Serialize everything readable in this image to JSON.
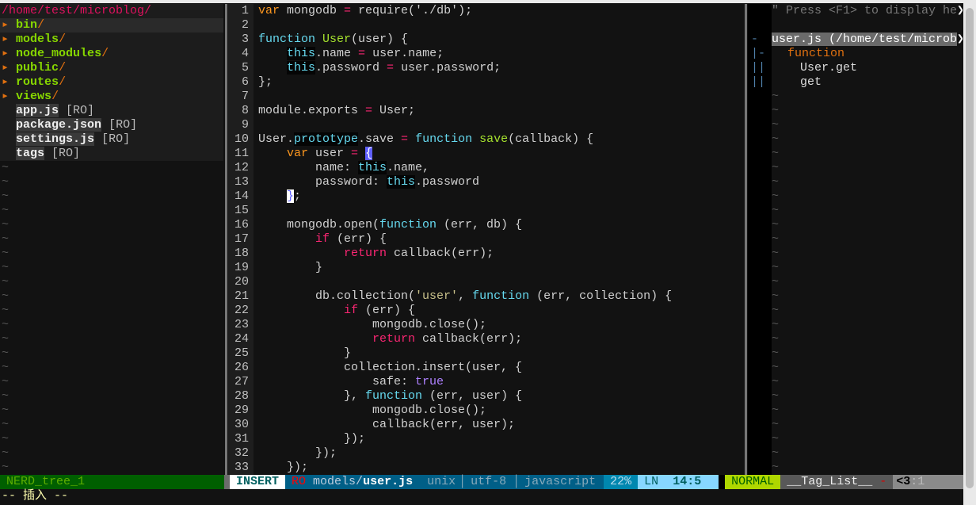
{
  "tree": {
    "root": "/home/test/microblog/",
    "dirs": [
      "bin",
      "models",
      "node_modules",
      "public",
      "routes",
      "views"
    ],
    "files": [
      "app.js",
      "package.json",
      "settings.js",
      "tags"
    ],
    "ro_label": "[RO]",
    "dir_arrow": "▸"
  },
  "code": {
    "lines": [
      [
        [
          "var",
          "kw"
        ],
        " mongodb ",
        [
          "=",
          "op"
        ],
        " require('./db');"
      ],
      [],
      [
        [
          "function",
          "fn"
        ],
        " ",
        [
          "User",
          "def"
        ],
        "(user) {"
      ],
      [
        "    ",
        [
          "this",
          "this"
        ],
        ".name ",
        [
          "=",
          "op"
        ],
        " user.name;"
      ],
      [
        "    ",
        [
          "this",
          "this"
        ],
        ".password ",
        [
          "=",
          "op"
        ],
        " user.password;"
      ],
      [
        "};"
      ],
      [],
      [
        "module.exports ",
        [
          "=",
          "op"
        ],
        " User;"
      ],
      [],
      [
        "User.",
        [
          "prototype",
          "this"
        ],
        ".save ",
        [
          "=",
          "op"
        ],
        " ",
        [
          "function",
          "fn"
        ],
        " ",
        [
          "save",
          "def"
        ],
        "(callback) {"
      ],
      [
        "    ",
        [
          "var",
          "kw"
        ],
        " user ",
        [
          "=",
          "op"
        ],
        " ",
        [
          "{",
          "brace"
        ]
      ],
      [
        "        name: ",
        [
          "this",
          "this"
        ],
        ".name,"
      ],
      [
        "        password: ",
        [
          "this",
          "this"
        ],
        ".password"
      ],
      [
        "    ",
        [
          "}",
          "brace2"
        ],
        ";"
      ],
      [],
      [
        "    mongodb.open(",
        [
          "function",
          "fn"
        ],
        " (err, db) {"
      ],
      [
        "        ",
        [
          "if",
          "ctl"
        ],
        " (err) {"
      ],
      [
        "            ",
        [
          "return",
          "ctl"
        ],
        " callback(err);"
      ],
      [
        "        }"
      ],
      [],
      [
        "        db.collection(",
        [
          "'user'",
          "str"
        ],
        ", ",
        [
          "function",
          "fn"
        ],
        " (err, collection) {"
      ],
      [
        "            ",
        [
          "if",
          "ctl"
        ],
        " (err) {"
      ],
      [
        "                mongodb.close();"
      ],
      [
        "                ",
        [
          "return",
          "ctl"
        ],
        " callback(err);"
      ],
      [
        "            }"
      ],
      [
        "            collection.insert(user, {"
      ],
      [
        "                safe: ",
        [
          "true",
          "bool"
        ]
      ],
      [
        "            }, ",
        [
          "function",
          "fn"
        ],
        " (err, user) {"
      ],
      [
        "                mongodb.close();"
      ],
      [
        "                callback(err, user);"
      ],
      [
        "            });"
      ],
      [
        "        });"
      ],
      [
        "    });"
      ]
    ]
  },
  "fold": [
    "",
    "",
    "-",
    "|-",
    "||",
    "||"
  ],
  "taglist": {
    "help": "\" Press <F1> to display he",
    "file": "user.js (/home/test/microb",
    "more": "❯",
    "type": "function",
    "tags": [
      "User.get",
      "get"
    ]
  },
  "status": {
    "nerd": "NERD_tree_1",
    "mode": "INSERT",
    "ro": "RO",
    "path_dir": "models/",
    "path_file": "user.js",
    "format": "unix",
    "encoding": "utf-8",
    "filetype": "javascript",
    "percent": "22%",
    "ln_label": "LN",
    "position": "14:5",
    "right_mode": "NORMAL",
    "right_name": "__Tag_List__",
    "right_mod": "-",
    "right_pos_a": "<3",
    "right_pos_b": ":1"
  },
  "cmdline": "-- 插入 --",
  "colors": {
    "nerd_bg": "#005f00",
    "insert_bg": "#ffffff",
    "file_bg": "#005f87",
    "percent_bg": "#0087af",
    "ln_bg": "#87d7ff",
    "normal_bg": "#afd700"
  }
}
